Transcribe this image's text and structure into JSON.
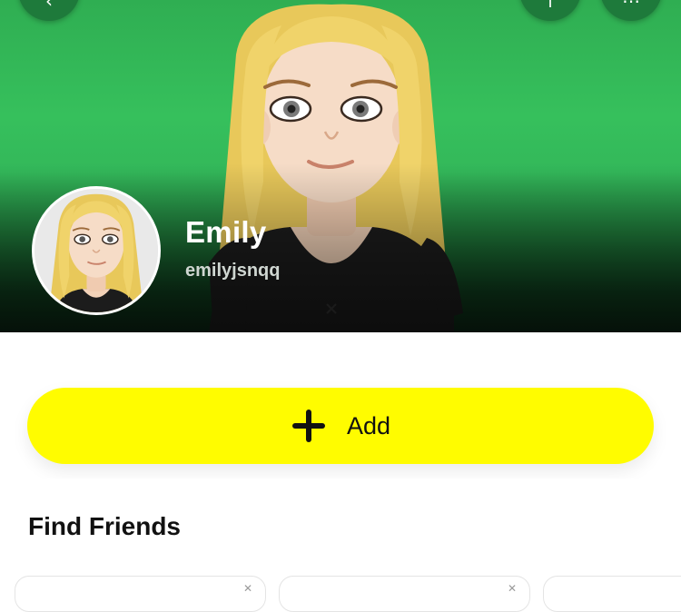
{
  "profile": {
    "display_name": "Emily",
    "username": "emilyjsnqq"
  },
  "actions": {
    "add_label": "Add"
  },
  "find_friends": {
    "title": "Find Friends",
    "cards_visible": 3
  },
  "icons": {
    "back": "back-arrow-icon",
    "share": "share-icon",
    "more": "more-options-icon",
    "add": "plus-icon",
    "dismiss": "close-icon"
  },
  "colors": {
    "hero_green": "#36c05c",
    "add_button": "#fffc00",
    "text_dark": "#111111",
    "username_gray": "#cfd6d1"
  }
}
